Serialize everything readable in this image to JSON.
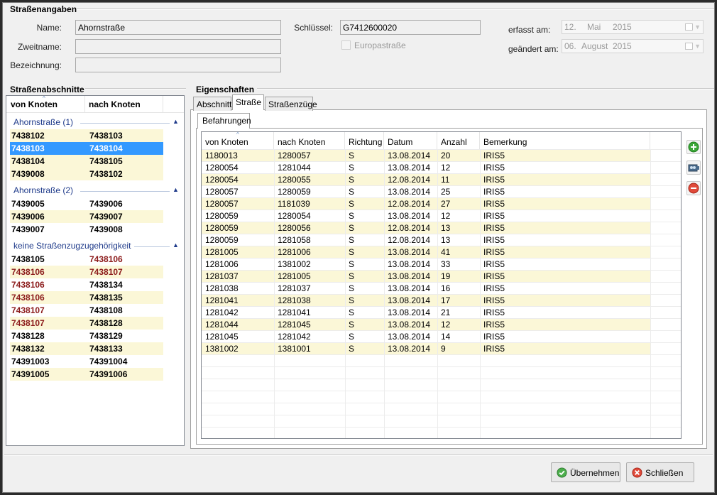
{
  "strassenangaben": {
    "title": "Straßenangaben",
    "name_label": "Name:",
    "name_value": "Ahornstraße",
    "zweitname_label": "Zweitname:",
    "zweitname_value": "",
    "bezeichnung_label": "Bezeichnung:",
    "bezeichnung_value": "",
    "schluessel_label": "Schlüssel:",
    "schluessel_value": "G7412600020",
    "europastrasse_label": "Europastraße",
    "europastrasse_checked": false,
    "erfasst_label": "erfasst am:",
    "erfasst_day": "12.",
    "erfasst_month": "Mai",
    "erfasst_year": "2015",
    "geaendert_label": "geändert am:",
    "geaendert_day": "06.",
    "geaendert_month": "August",
    "geaendert_year": "2015"
  },
  "abschnitte": {
    "title": "Straßenabschnitte",
    "col_von": "von Knoten",
    "col_nach": "nach Knoten",
    "groups": [
      {
        "label": "Ahornstraße (1)"
      },
      {
        "label": "Ahornstraße (2)"
      },
      {
        "label": "keine Straßenzugzugehörigkeit"
      }
    ],
    "rows": [
      {
        "von": "7438102",
        "nach": "7438103"
      },
      {
        "von": "7438103",
        "nach": "7438104"
      },
      {
        "von": "7438104",
        "nach": "7438105"
      },
      {
        "von": "7439008",
        "nach": "7438102"
      },
      {
        "von": "7439005",
        "nach": "7439006"
      },
      {
        "von": "7439006",
        "nach": "7439007"
      },
      {
        "von": "7439007",
        "nach": "7439008"
      },
      {
        "von": "7438105",
        "nach": "7438106"
      },
      {
        "von": "7438106",
        "nach": "7438107"
      },
      {
        "von": "7438106",
        "nach": "7438134"
      },
      {
        "von": "7438106",
        "nach": "7438135"
      },
      {
        "von": "7438107",
        "nach": "7438108"
      },
      {
        "von": "7438107",
        "nach": "7438128"
      },
      {
        "von": "7438128",
        "nach": "7438129"
      },
      {
        "von": "7438132",
        "nach": "7438133"
      },
      {
        "von": "74391003",
        "nach": "74391004"
      },
      {
        "von": "74391005",
        "nach": "74391006"
      }
    ]
  },
  "eigenschaften": {
    "title": "Eigenschaften",
    "tabs": [
      "Abschnitt",
      "Straße",
      "Straßenzüge"
    ],
    "active_tab": "Straße",
    "subtab": "Befahrungen",
    "columns": [
      "von Knoten",
      "nach Knoten",
      "Richtung",
      "Datum",
      "Anzahl",
      "Bemerkung"
    ],
    "rows": [
      [
        "1180013",
        "1280057",
        "S",
        "13.08.2014",
        "20",
        "IRIS5"
      ],
      [
        "1280054",
        "1281044",
        "S",
        "13.08.2014",
        "12",
        "IRIS5"
      ],
      [
        "1280054",
        "1280055",
        "S",
        "12.08.2014",
        "11",
        "IRIS5"
      ],
      [
        "1280057",
        "1280059",
        "S",
        "13.08.2014",
        "25",
        "IRIS5"
      ],
      [
        "1280057",
        "1181039",
        "S",
        "12.08.2014",
        "27",
        "IRIS5"
      ],
      [
        "1280059",
        "1280054",
        "S",
        "13.08.2014",
        "12",
        "IRIS5"
      ],
      [
        "1280059",
        "1280056",
        "S",
        "12.08.2014",
        "13",
        "IRIS5"
      ],
      [
        "1280059",
        "1281058",
        "S",
        "12.08.2014",
        "13",
        "IRIS5"
      ],
      [
        "1281005",
        "1281006",
        "S",
        "13.08.2014",
        "41",
        "IRIS5"
      ],
      [
        "1281006",
        "1381002",
        "S",
        "13.08.2014",
        "33",
        "IRIS5"
      ],
      [
        "1281037",
        "1281005",
        "S",
        "13.08.2014",
        "19",
        "IRIS5"
      ],
      [
        "1281038",
        "1281037",
        "S",
        "13.08.2014",
        "16",
        "IRIS5"
      ],
      [
        "1281041",
        "1281038",
        "S",
        "13.08.2014",
        "17",
        "IRIS5"
      ],
      [
        "1281042",
        "1281041",
        "S",
        "13.08.2014",
        "21",
        "IRIS5"
      ],
      [
        "1281044",
        "1281045",
        "S",
        "13.08.2014",
        "12",
        "IRIS5"
      ],
      [
        "1281045",
        "1281042",
        "S",
        "13.08.2014",
        "14",
        "IRIS5"
      ],
      [
        "1381002",
        "1381001",
        "S",
        "13.08.2014",
        "9",
        "IRIS5"
      ]
    ]
  },
  "icons": {
    "add": "add-icon",
    "edit": "camera-icon",
    "remove": "remove-icon",
    "ok": "check-icon",
    "close": "close-icon"
  },
  "colors": {
    "selection": "#3399ff",
    "alt_row": "#fbf7d7",
    "red_text": "#8b1a1a",
    "group_blue": "#1e3a8a"
  },
  "buttons": {
    "apply": "Übernehmen",
    "close": "Schließen"
  }
}
